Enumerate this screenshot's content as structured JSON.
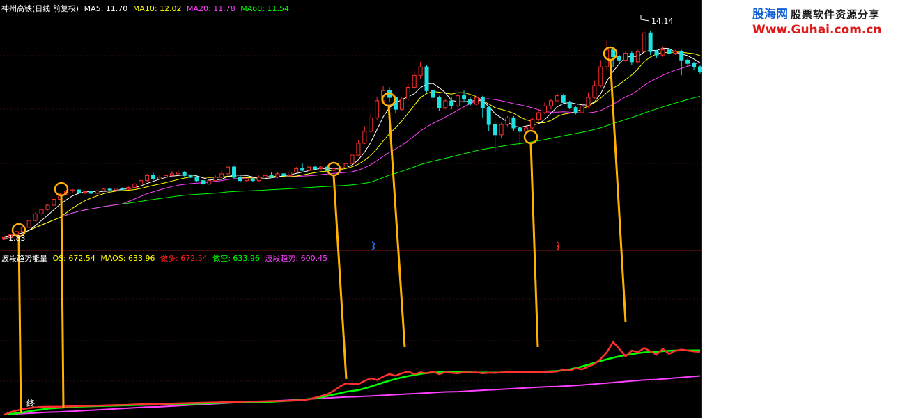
{
  "price_panel": {
    "title": "神州高铁(日线 前复权)",
    "indicators": [
      {
        "label": "MA5: 11.70",
        "color": "#ffffff"
      },
      {
        "label": "MA10: 12.02",
        "color": "#ffff00"
      },
      {
        "label": "MA20: 11.78",
        "color": "#ff40ff"
      },
      {
        "label": "MA60: 11.54",
        "color": "#00ff00"
      }
    ],
    "high_label": "14.14",
    "low_label": "1.83"
  },
  "energy_panel": {
    "title": "波段趋势能量",
    "indicators": [
      {
        "label": "OS: 672.54",
        "color": "#ffff00"
      },
      {
        "label": "MAOS: 633.96",
        "color": "#ffff00"
      },
      {
        "label": "做多: 672.54",
        "color": "#ff2020"
      },
      {
        "label": "做空: 633.96",
        "color": "#00ff00"
      },
      {
        "label": "波段趋势: 600.45",
        "color": "#ff40ff"
      }
    ],
    "end_label": "终"
  },
  "watermark": {
    "logo": "股海网",
    "slogan": "股票软件资源分享",
    "url": "Www.Guhai.com.cn"
  },
  "colors": {
    "background": "#000000",
    "up_candle": "#ff3030",
    "down_candle": "#20e0e0",
    "ma5": "#ffffff",
    "ma10": "#ffff00",
    "ma20": "#ff40ff",
    "ma60": "#00ff00",
    "marker": "#ffb000"
  },
  "chart_data": [
    {
      "type": "candlestick",
      "ylim": [
        1.6,
        15.2
      ],
      "candles": [
        [
          1.85,
          1.95,
          1.8,
          1.98
        ],
        [
          1.95,
          2.1,
          1.92,
          2.12
        ],
        [
          2.1,
          2.3,
          2.05,
          2.32
        ],
        [
          2.3,
          2.55,
          2.25,
          2.58
        ],
        [
          2.55,
          2.95,
          2.5,
          3.0
        ],
        [
          2.95,
          3.35,
          2.9,
          3.4
        ],
        [
          3.35,
          3.6,
          3.3,
          3.65
        ],
        [
          3.6,
          3.85,
          3.55,
          3.9
        ],
        [
          3.85,
          4.2,
          3.8,
          4.25
        ],
        [
          4.2,
          4.5,
          4.15,
          4.55
        ],
        [
          4.5,
          4.7,
          4.45,
          4.75
        ],
        [
          4.7,
          4.75,
          4.6,
          4.8
        ],
        [
          4.75,
          4.6,
          4.55,
          4.8
        ],
        [
          4.6,
          4.65,
          4.5,
          4.7
        ],
        [
          4.65,
          4.55,
          4.5,
          4.7
        ],
        [
          4.55,
          4.7,
          4.5,
          4.75
        ],
        [
          4.7,
          4.8,
          4.65,
          4.85
        ],
        [
          4.8,
          4.75,
          4.7,
          4.85
        ],
        [
          4.75,
          4.85,
          4.7,
          4.9
        ],
        [
          4.85,
          4.8,
          4.75,
          4.9
        ],
        [
          4.8,
          4.9,
          4.75,
          4.95
        ],
        [
          4.9,
          5.1,
          4.85,
          5.15
        ],
        [
          5.1,
          5.3,
          5.05,
          5.4
        ],
        [
          5.3,
          5.6,
          5.25,
          5.7
        ],
        [
          5.6,
          5.4,
          5.3,
          5.75
        ],
        [
          5.4,
          5.5,
          5.35,
          5.6
        ],
        [
          5.5,
          5.6,
          5.45,
          5.65
        ],
        [
          5.6,
          5.7,
          5.55,
          5.85
        ],
        [
          5.7,
          5.8,
          5.65,
          5.9
        ],
        [
          5.8,
          5.6,
          5.55,
          5.85
        ],
        [
          5.6,
          5.5,
          5.45,
          5.65
        ],
        [
          5.5,
          5.3,
          5.25,
          5.55
        ],
        [
          5.3,
          5.1,
          5.0,
          5.35
        ],
        [
          5.1,
          5.3,
          5.05,
          5.35
        ],
        [
          5.3,
          5.5,
          5.25,
          5.6
        ],
        [
          5.5,
          5.7,
          5.45,
          5.9
        ],
        [
          5.7,
          6.1,
          5.65,
          6.2
        ],
        [
          6.1,
          5.5,
          5.4,
          6.2
        ],
        [
          5.5,
          5.3,
          5.2,
          5.6
        ],
        [
          5.3,
          5.4,
          5.25,
          5.45
        ],
        [
          5.4,
          5.3,
          5.25,
          5.45
        ],
        [
          5.3,
          5.5,
          5.25,
          5.6
        ],
        [
          5.5,
          5.6,
          5.45,
          5.65
        ],
        [
          5.6,
          5.5,
          5.45,
          5.8
        ],
        [
          5.5,
          5.7,
          5.45,
          5.8
        ],
        [
          5.7,
          5.6,
          5.55,
          5.75
        ],
        [
          5.6,
          5.8,
          5.55,
          5.9
        ],
        [
          5.8,
          6.0,
          5.75,
          6.1
        ],
        [
          6.0,
          5.9,
          5.85,
          6.3
        ],
        [
          5.9,
          6.1,
          5.85,
          6.2
        ],
        [
          6.1,
          6.0,
          5.95,
          6.15
        ],
        [
          6.0,
          6.1,
          5.95,
          6.15
        ],
        [
          6.1,
          5.9,
          5.85,
          6.15
        ],
        [
          5.9,
          6.0,
          5.85,
          6.05
        ],
        [
          6.0,
          6.05,
          5.95,
          6.1
        ],
        [
          6.05,
          6.3,
          6.0,
          6.4
        ],
        [
          6.3,
          6.8,
          6.25,
          6.9
        ],
        [
          6.8,
          7.5,
          6.75,
          7.7
        ],
        [
          7.5,
          8.2,
          7.45,
          8.5
        ],
        [
          8.2,
          9.0,
          8.1,
          9.3
        ],
        [
          9.0,
          10.0,
          8.9,
          10.2
        ],
        [
          10.0,
          10.6,
          9.8,
          10.9
        ],
        [
          10.6,
          10.2,
          9.9,
          10.8
        ],
        [
          10.2,
          9.5,
          9.3,
          10.3
        ],
        [
          9.5,
          10.1,
          9.4,
          10.2
        ],
        [
          10.1,
          10.8,
          10.0,
          11.0
        ],
        [
          10.8,
          11.5,
          10.7,
          11.8
        ],
        [
          11.5,
          12.0,
          11.3,
          12.3
        ],
        [
          12.0,
          10.6,
          10.5,
          12.1
        ],
        [
          10.6,
          10.2,
          10.0,
          10.7
        ],
        [
          10.2,
          9.6,
          9.4,
          10.3
        ],
        [
          9.6,
          10.0,
          9.5,
          10.1
        ],
        [
          10.0,
          9.7,
          9.5,
          10.2
        ],
        [
          9.7,
          10.3,
          9.6,
          10.4
        ],
        [
          10.3,
          10.1,
          9.9,
          10.6
        ],
        [
          10.1,
          9.8,
          9.7,
          10.2
        ],
        [
          9.8,
          10.2,
          9.7,
          10.3
        ],
        [
          10.2,
          9.6,
          9.0,
          10.3
        ],
        [
          9.6,
          8.6,
          8.2,
          9.7
        ],
        [
          8.6,
          8.0,
          7.0,
          8.8
        ],
        [
          8.0,
          8.6,
          7.8,
          8.7
        ],
        [
          8.6,
          9.0,
          8.5,
          9.1
        ],
        [
          9.0,
          8.4,
          8.2,
          9.1
        ],
        [
          8.4,
          8.2,
          7.4,
          8.5
        ],
        [
          8.2,
          8.4,
          8.1,
          8.5
        ],
        [
          8.4,
          8.9,
          8.3,
          9.0
        ],
        [
          8.9,
          9.3,
          8.8,
          9.5
        ],
        [
          9.3,
          9.7,
          9.2,
          9.9
        ],
        [
          9.7,
          10.0,
          9.5,
          10.1
        ],
        [
          10.0,
          10.3,
          9.9,
          10.5
        ],
        [
          10.3,
          9.9,
          9.8,
          10.4
        ],
        [
          9.9,
          9.6,
          9.5,
          10.0
        ],
        [
          9.6,
          9.3,
          9.2,
          9.7
        ],
        [
          9.3,
          9.7,
          9.2,
          9.8
        ],
        [
          9.7,
          10.2,
          9.6,
          10.5
        ],
        [
          10.2,
          10.9,
          10.1,
          11.2
        ],
        [
          10.9,
          12.0,
          10.8,
          12.4
        ],
        [
          12.0,
          13.0,
          11.8,
          13.6
        ],
        [
          13.0,
          12.6,
          12.0,
          13.1
        ],
        [
          12.6,
          12.4,
          12.2,
          12.7
        ],
        [
          12.4,
          12.8,
          12.3,
          12.9
        ],
        [
          12.8,
          12.3,
          12.1,
          12.9
        ],
        [
          12.3,
          12.9,
          12.2,
          13.0
        ],
        [
          12.9,
          14.0,
          12.8,
          14.14
        ],
        [
          14.0,
          12.9,
          12.7,
          14.1
        ],
        [
          12.9,
          12.7,
          12.5,
          13.0
        ],
        [
          12.7,
          13.0,
          12.6,
          13.2
        ],
        [
          13.0,
          12.8,
          12.6,
          13.1
        ],
        [
          12.8,
          12.9,
          12.7,
          13.0
        ],
        [
          12.9,
          12.4,
          11.5,
          13.0
        ],
        [
          12.4,
          12.2,
          12.0,
          12.5
        ],
        [
          12.2,
          12.0,
          11.8,
          12.3
        ],
        [
          12.0,
          11.7,
          11.6,
          12.1
        ]
      ]
    },
    {
      "type": "line",
      "ylim": [
        0,
        900
      ],
      "series": [
        {
          "name": "做多",
          "values": [
            0,
            14,
            24,
            32,
            38,
            42,
            45,
            46,
            46,
            48,
            49,
            50,
            51,
            52,
            53,
            54,
            55,
            56,
            57,
            58,
            60,
            61,
            62,
            63,
            64,
            65,
            66,
            67,
            68,
            69,
            70,
            71,
            72,
            73,
            74,
            75,
            76,
            77,
            78,
            79,
            80,
            80,
            81,
            82,
            84,
            85,
            90,
            100,
            110,
            120,
            140,
            165,
            185,
            180,
            200,
            215,
            205,
            225,
            240,
            230,
            245,
            255,
            240,
            250,
            245,
            255,
            240,
            250,
            245,
            250,
            248,
            250,
            245,
            248,
            247,
            250,
            250,
            252,
            250,
            252,
            250,
            251,
            250,
            255,
            268,
            260,
            275,
            268,
            285,
            300,
            330,
            370,
            430,
            390,
            345,
            380,
            370,
            395,
            355,
            390,
            360,
            378,
            385,
            380,
            375,
            372
          ]
        },
        {
          "name": "做空",
          "values": [
            0,
            4,
            8,
            13,
            19,
            25,
            30,
            35,
            40,
            43,
            45,
            47,
            48,
            49,
            50,
            51,
            52,
            53,
            54,
            55,
            56,
            57,
            58,
            59,
            60,
            61,
            62,
            63,
            64,
            65,
            66,
            67,
            68,
            69,
            70,
            71,
            72,
            73,
            74,
            75,
            76,
            78,
            80,
            82,
            85,
            88,
            92,
            97,
            103,
            110,
            118,
            126,
            135,
            145,
            155,
            166,
            178,
            190,
            201,
            211,
            220,
            228,
            235,
            241,
            246,
            249,
            251,
            252,
            252,
            251,
            250,
            249,
            249,
            249,
            249,
            249,
            250,
            250,
            251,
            251,
            252,
            253,
            255,
            258,
            262,
            268,
            276,
            285,
            296,
            307,
            318,
            328,
            337,
            345,
            352,
            358,
            364,
            369,
            373,
            376,
            378,
            380,
            381,
            381,
            381,
            381
          ]
        },
        {
          "name": "波段趋势",
          "values": [
            0,
            2,
            4,
            6,
            8,
            10,
            12,
            14,
            16,
            18,
            20,
            22,
            24,
            26,
            28,
            30,
            32,
            34,
            36,
            38,
            40,
            42,
            44,
            46,
            48,
            50,
            52,
            54,
            56,
            58,
            60,
            62,
            64,
            66,
            68,
            70,
            72,
            74,
            76,
            78,
            80,
            82,
            84,
            86,
            88,
            90,
            92,
            94,
            96,
            98,
            100,
            102,
            104,
            106,
            108,
            110,
            112,
            114,
            116,
            118,
            120,
            122,
            124,
            126,
            128,
            130,
            132,
            134,
            136,
            138,
            140,
            142,
            144,
            146,
            148,
            150,
            152,
            154,
            156,
            158,
            160,
            162,
            164,
            166,
            168,
            170,
            172,
            175,
            178,
            181,
            184,
            187,
            190,
            193,
            196,
            199,
            202,
            205,
            208,
            211,
            214,
            217,
            220,
            223,
            226,
            229
          ]
        }
      ]
    }
  ]
}
